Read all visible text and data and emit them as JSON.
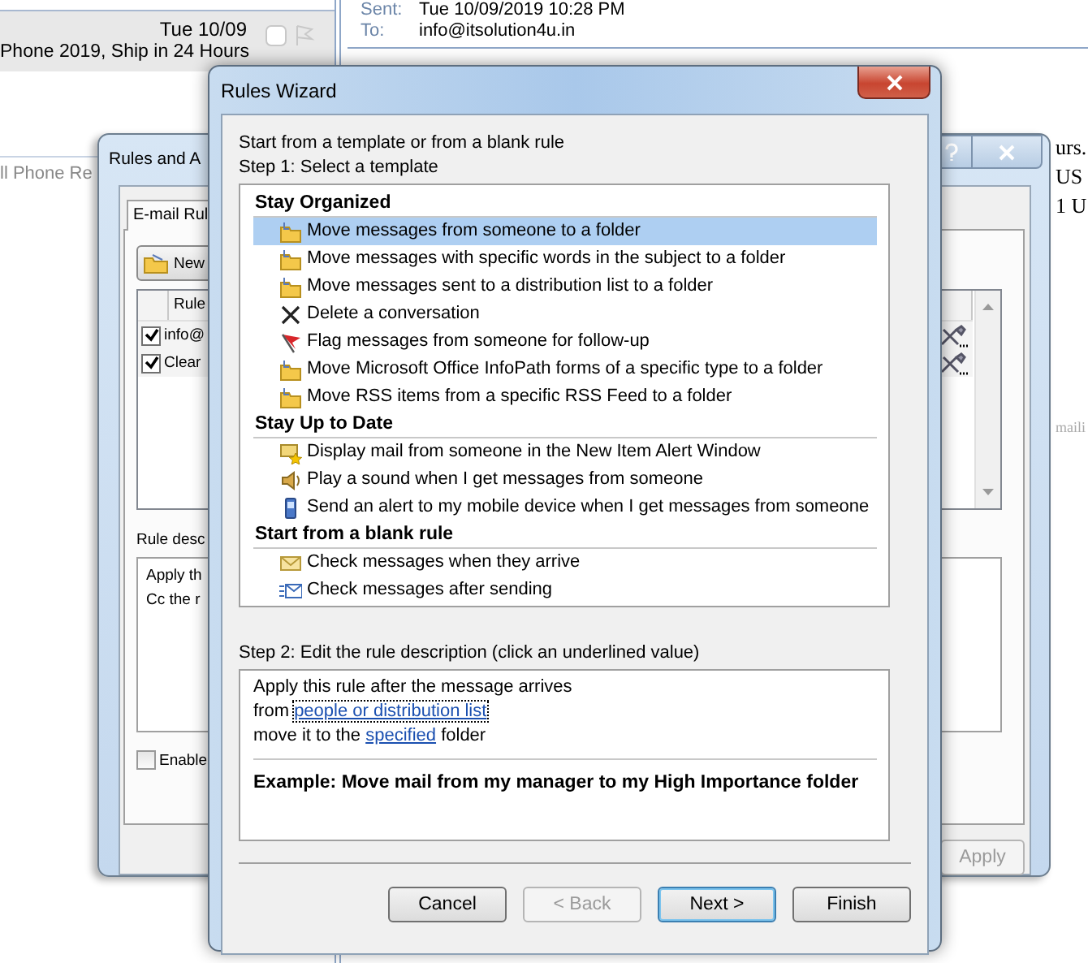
{
  "mail_list": {
    "date": "Tue 10/09",
    "subject": "Phone 2019, Ship in 24 Hours",
    "preview": "ll Phone Re"
  },
  "reading_pane": {
    "headers": [
      {
        "label": "Sent:",
        "value": "Tue 10/09/2019 10:28 PM"
      },
      {
        "label": "To:",
        "value": "info@itsolution4u.in"
      }
    ],
    "body_lines": [
      "urs.",
      "US",
      "1 U"
    ],
    "footer_text": "maili"
  },
  "rules_and_alerts": {
    "title": "Rules and A",
    "tabs": [
      {
        "label": "E-mail Rul",
        "selected": true
      }
    ],
    "new_button": "New",
    "rules_columns": [
      "Rule"
    ],
    "rules": [
      {
        "name": "info@",
        "checked": true
      },
      {
        "name": "Clear",
        "checked": true
      }
    ],
    "description_label": "Rule desc",
    "description_lines": [
      "Apply th",
      "Cc the r"
    ],
    "enable_checkbox": {
      "label": "Enable",
      "checked": false
    },
    "apply_button": {
      "label": "Apply",
      "disabled": true
    }
  },
  "rules_wizard": {
    "title": "Rules Wizard",
    "intro": "Start from a template or from a blank rule",
    "step1_label": "Step 1: Select a template",
    "template_groups": [
      {
        "title": "Stay Organized",
        "items": [
          {
            "label": "Move messages from someone to a folder",
            "kind": "folder",
            "selected": true
          },
          {
            "label": "Move messages with specific words in the subject to a folder",
            "kind": "folder",
            "selected": false
          },
          {
            "label": "Move messages sent to a distribution list to a folder",
            "kind": "folder",
            "selected": false
          },
          {
            "label": "Delete a conversation",
            "kind": "delete",
            "selected": false
          },
          {
            "label": "Flag messages from someone for follow-up",
            "kind": "flag",
            "selected": false
          },
          {
            "label": "Move Microsoft Office InfoPath forms of a specific type to a folder",
            "kind": "folder",
            "selected": false
          },
          {
            "label": "Move RSS items from a specific RSS Feed to a folder",
            "kind": "folder",
            "selected": false
          }
        ]
      },
      {
        "title": "Stay Up to Date",
        "items": [
          {
            "label": "Display mail from someone in the New Item Alert Window",
            "kind": "alert",
            "selected": false
          },
          {
            "label": "Play a sound when I get messages from someone",
            "kind": "sound",
            "selected": false
          },
          {
            "label": "Send an alert to my mobile device when I get messages from someone",
            "kind": "mobile",
            "selected": false
          }
        ]
      },
      {
        "title": "Start from a blank rule",
        "items": [
          {
            "label": "Check messages when they arrive",
            "kind": "envelope",
            "selected": false
          },
          {
            "label": "Check messages after sending",
            "kind": "send",
            "selected": false
          }
        ]
      }
    ],
    "step2_label": "Step 2: Edit the rule description (click an underlined value)",
    "description_lines": [
      [
        {
          "text": "Apply this rule after the message arrives",
          "kind": "text"
        }
      ],
      [
        {
          "text": "from ",
          "kind": "text"
        },
        {
          "text": "people or distribution list",
          "kind": "link",
          "focused": true
        }
      ],
      [
        {
          "text": "move it to the ",
          "kind": "text"
        },
        {
          "text": "specified",
          "kind": "link",
          "focused": false
        },
        {
          "text": " folder",
          "kind": "text"
        }
      ]
    ],
    "example": "Example: Move mail from my manager to my High Importance folder",
    "buttons": [
      {
        "label": "Cancel",
        "disabled": false,
        "default": false
      },
      {
        "label": "< Back",
        "disabled": true,
        "default": false
      },
      {
        "label": "Next >",
        "disabled": false,
        "default": true
      },
      {
        "label": "Finish",
        "disabled": false,
        "default": false
      }
    ]
  }
}
